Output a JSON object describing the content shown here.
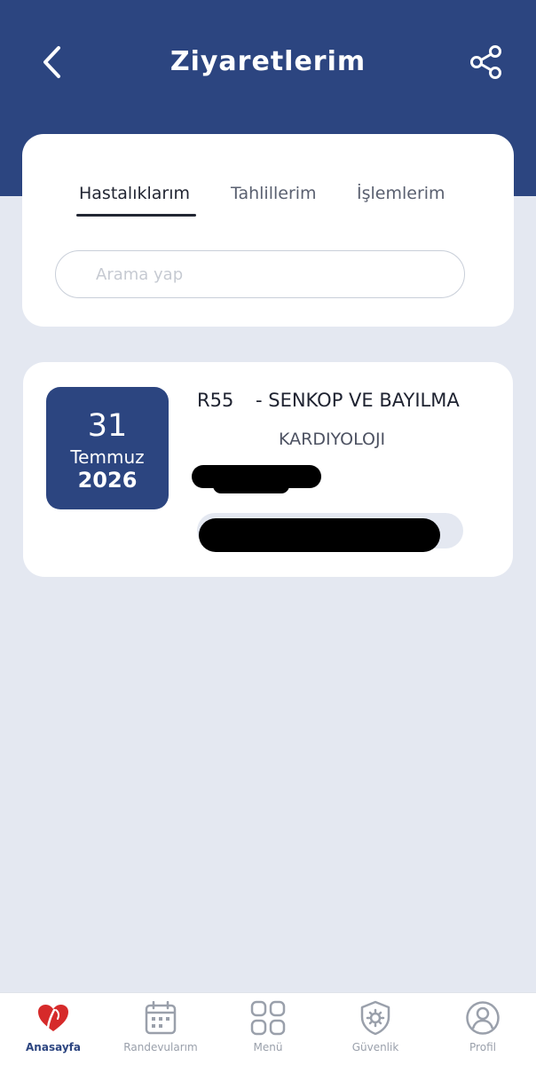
{
  "header": {
    "title": "Ziyaretlerim",
    "back_icon": "chevron-left-icon",
    "share_icon": "share-icon"
  },
  "tabs": [
    {
      "label": "Hastalıklarım",
      "active": true
    },
    {
      "label": "Tahlillerim",
      "active": false
    },
    {
      "label": "İşlemlerim",
      "active": false
    }
  ],
  "search": {
    "placeholder": "Arama yap",
    "value": ""
  },
  "visits": [
    {
      "day": "31",
      "month": "Temmuz",
      "year": "2026",
      "code": "R55",
      "diagnosis": "- SENKOP VE BAYILMA",
      "department": "KARDIYOLOJI"
    }
  ],
  "bottom_nav": [
    {
      "label": "Anasayfa",
      "icon": "heart-logo-icon",
      "active": true
    },
    {
      "label": "Randevularım",
      "icon": "calendar-icon",
      "active": false
    },
    {
      "label": "Menü",
      "icon": "grid-icon",
      "active": false
    },
    {
      "label": "Güvenlik",
      "icon": "shield-gear-icon",
      "active": false
    },
    {
      "label": "Profil",
      "icon": "user-icon",
      "active": false
    }
  ],
  "colors": {
    "primary": "#2c4580",
    "background": "#e4e8f1",
    "card": "#ffffff",
    "logo_red": "#d62a2a"
  }
}
